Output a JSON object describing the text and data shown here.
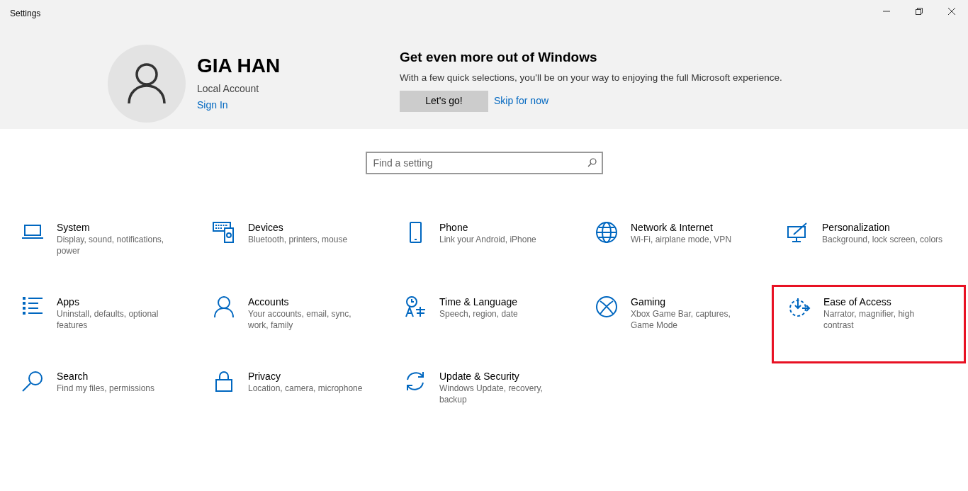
{
  "window": {
    "title": "Settings"
  },
  "account": {
    "name": "GIA HAN",
    "type": "Local Account",
    "sign_in": "Sign In"
  },
  "promo": {
    "title": "Get even more out of Windows",
    "text": "With a few quick selections, you'll be on your way to enjoying the full Microsoft experience.",
    "primary": "Let's go!",
    "secondary": "Skip for now"
  },
  "search": {
    "placeholder": "Find a setting"
  },
  "tiles": [
    {
      "kind": "system",
      "title": "System",
      "description": "Display, sound, notifications, power",
      "highlighted": false
    },
    {
      "kind": "devices",
      "title": "Devices",
      "description": "Bluetooth, printers, mouse",
      "highlighted": false
    },
    {
      "kind": "phone",
      "title": "Phone",
      "description": "Link your Android, iPhone",
      "highlighted": false
    },
    {
      "kind": "network",
      "title": "Network & Internet",
      "description": "Wi-Fi, airplane mode, VPN",
      "highlighted": false
    },
    {
      "kind": "personalization",
      "title": "Personalization",
      "description": "Background, lock screen, colors",
      "highlighted": false
    },
    {
      "kind": "apps",
      "title": "Apps",
      "description": "Uninstall, defaults, optional features",
      "highlighted": false
    },
    {
      "kind": "accounts",
      "title": "Accounts",
      "description": "Your accounts, email, sync, work, family",
      "highlighted": false
    },
    {
      "kind": "time",
      "title": "Time & Language",
      "description": "Speech, region, date",
      "highlighted": false
    },
    {
      "kind": "gaming",
      "title": "Gaming",
      "description": "Xbox Game Bar, captures, Game Mode",
      "highlighted": false
    },
    {
      "kind": "access",
      "title": "Ease of Access",
      "description": "Narrator, magnifier, high contrast",
      "highlighted": true
    },
    {
      "kind": "search",
      "title": "Search",
      "description": "Find my files, permissions",
      "highlighted": false
    },
    {
      "kind": "privacy",
      "title": "Privacy",
      "description": "Location, camera, microphone",
      "highlighted": false
    },
    {
      "kind": "update",
      "title": "Update & Security",
      "description": "Windows Update, recovery, backup",
      "highlighted": false
    }
  ]
}
